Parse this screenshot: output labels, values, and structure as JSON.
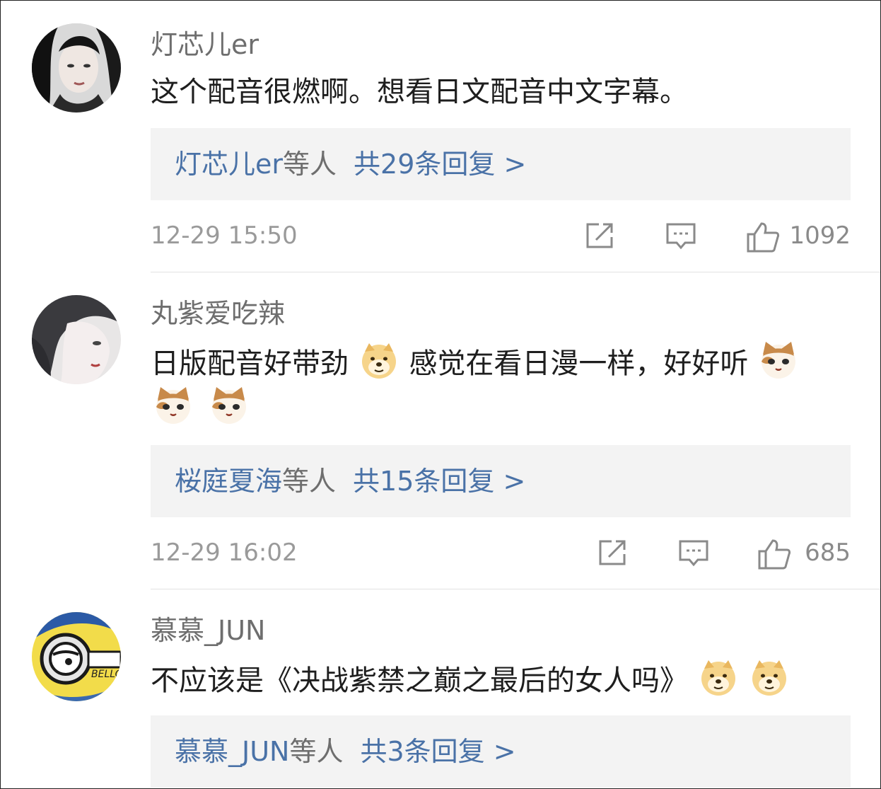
{
  "comments": [
    {
      "username": "灯芯儿er",
      "lines": [
        [
          "这个配音很燃啊。想看日文配音中文字幕。"
        ]
      ],
      "replies": {
        "names": "灯芯儿er",
        "suffix": "等人",
        "count_label": "共29条回复 >"
      },
      "timestamp": "12-29 15:50",
      "likes": "1092"
    },
    {
      "username": "丸紫爱吃辣",
      "line1_a": "日版配音好带劲",
      "line1_b": "感觉在看日漫一样，好好听",
      "replies": {
        "names": "桜庭夏海",
        "suffix": "等人",
        "count_label": "共15条回复 >"
      },
      "timestamp": "12-29 16:02",
      "likes": "685"
    },
    {
      "username": "慕慕_JUN",
      "line1": "不应该是《决战紫禁之巅之最后的女人吗》",
      "replies": {
        "names": "慕慕_JUN",
        "suffix": "等人",
        "count_label": "共3条回复 >"
      }
    }
  ],
  "icons": {
    "share": "share-icon",
    "comment": "comment-icon",
    "like": "thumbs-up-icon",
    "emoji_doge": "doge-emoji-icon",
    "emoji_cat": "cat-emoji-icon"
  },
  "colors": {
    "link": "#4a72a7",
    "username": "#6e6e6e",
    "text": "#1e1e1e",
    "meta": "#9a9a9a",
    "reply_bg": "#f3f3f3"
  },
  "avatar_text": "BELLO"
}
